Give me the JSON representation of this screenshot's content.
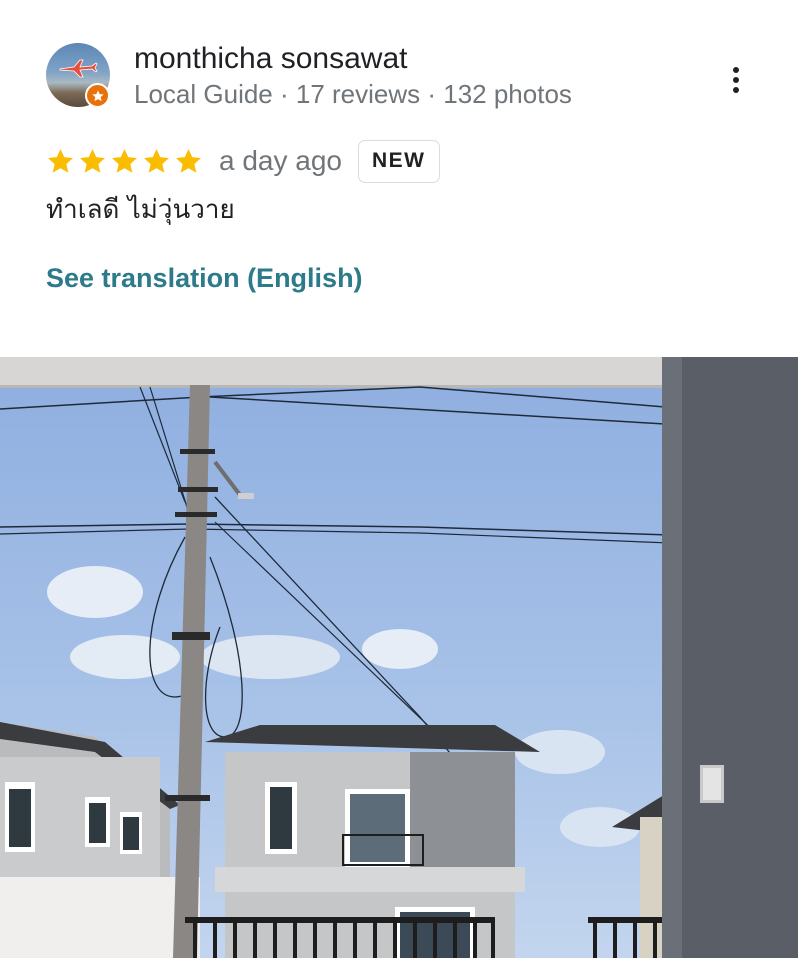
{
  "review": {
    "author": {
      "name": "monthicha sonsawat",
      "meta": "Local Guide · 17 reviews · 132 photos",
      "avatar_icon": "airplane-avatar",
      "badge_icon": "local-guide-star-icon",
      "badge_color": "#e8710a"
    },
    "rating": {
      "stars": 5,
      "max_stars": 5,
      "star_color": "#fbbc04"
    },
    "date": "a day ago",
    "badge": "NEW",
    "text": "ทำเลดี ไม่วุ่นวาย",
    "translate_link": "See translation (English)",
    "link_color": "#2c7a8a",
    "photo": {
      "subject": "Two-storey houses under a blue sky with a utility pole and power lines"
    },
    "menu_icon": "more-vert-icon"
  }
}
